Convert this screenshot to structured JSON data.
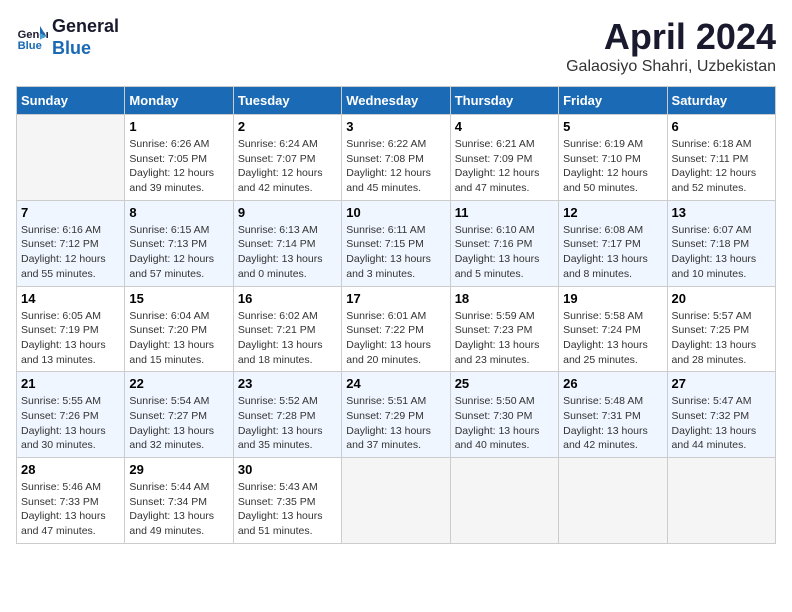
{
  "header": {
    "logo_line1": "General",
    "logo_line2": "Blue",
    "month_title": "April 2024",
    "location": "Galaosiyo Shahri, Uzbekistan"
  },
  "weekdays": [
    "Sunday",
    "Monday",
    "Tuesday",
    "Wednesday",
    "Thursday",
    "Friday",
    "Saturday"
  ],
  "weeks": [
    [
      {
        "day": "",
        "sunrise": "",
        "sunset": "",
        "daylight": ""
      },
      {
        "day": "1",
        "sunrise": "Sunrise: 6:26 AM",
        "sunset": "Sunset: 7:05 PM",
        "daylight": "Daylight: 12 hours and 39 minutes."
      },
      {
        "day": "2",
        "sunrise": "Sunrise: 6:24 AM",
        "sunset": "Sunset: 7:07 PM",
        "daylight": "Daylight: 12 hours and 42 minutes."
      },
      {
        "day": "3",
        "sunrise": "Sunrise: 6:22 AM",
        "sunset": "Sunset: 7:08 PM",
        "daylight": "Daylight: 12 hours and 45 minutes."
      },
      {
        "day": "4",
        "sunrise": "Sunrise: 6:21 AM",
        "sunset": "Sunset: 7:09 PM",
        "daylight": "Daylight: 12 hours and 47 minutes."
      },
      {
        "day": "5",
        "sunrise": "Sunrise: 6:19 AM",
        "sunset": "Sunset: 7:10 PM",
        "daylight": "Daylight: 12 hours and 50 minutes."
      },
      {
        "day": "6",
        "sunrise": "Sunrise: 6:18 AM",
        "sunset": "Sunset: 7:11 PM",
        "daylight": "Daylight: 12 hours and 52 minutes."
      }
    ],
    [
      {
        "day": "7",
        "sunrise": "Sunrise: 6:16 AM",
        "sunset": "Sunset: 7:12 PM",
        "daylight": "Daylight: 12 hours and 55 minutes."
      },
      {
        "day": "8",
        "sunrise": "Sunrise: 6:15 AM",
        "sunset": "Sunset: 7:13 PM",
        "daylight": "Daylight: 12 hours and 57 minutes."
      },
      {
        "day": "9",
        "sunrise": "Sunrise: 6:13 AM",
        "sunset": "Sunset: 7:14 PM",
        "daylight": "Daylight: 13 hours and 0 minutes."
      },
      {
        "day": "10",
        "sunrise": "Sunrise: 6:11 AM",
        "sunset": "Sunset: 7:15 PM",
        "daylight": "Daylight: 13 hours and 3 minutes."
      },
      {
        "day": "11",
        "sunrise": "Sunrise: 6:10 AM",
        "sunset": "Sunset: 7:16 PM",
        "daylight": "Daylight: 13 hours and 5 minutes."
      },
      {
        "day": "12",
        "sunrise": "Sunrise: 6:08 AM",
        "sunset": "Sunset: 7:17 PM",
        "daylight": "Daylight: 13 hours and 8 minutes."
      },
      {
        "day": "13",
        "sunrise": "Sunrise: 6:07 AM",
        "sunset": "Sunset: 7:18 PM",
        "daylight": "Daylight: 13 hours and 10 minutes."
      }
    ],
    [
      {
        "day": "14",
        "sunrise": "Sunrise: 6:05 AM",
        "sunset": "Sunset: 7:19 PM",
        "daylight": "Daylight: 13 hours and 13 minutes."
      },
      {
        "day": "15",
        "sunrise": "Sunrise: 6:04 AM",
        "sunset": "Sunset: 7:20 PM",
        "daylight": "Daylight: 13 hours and 15 minutes."
      },
      {
        "day": "16",
        "sunrise": "Sunrise: 6:02 AM",
        "sunset": "Sunset: 7:21 PM",
        "daylight": "Daylight: 13 hours and 18 minutes."
      },
      {
        "day": "17",
        "sunrise": "Sunrise: 6:01 AM",
        "sunset": "Sunset: 7:22 PM",
        "daylight": "Daylight: 13 hours and 20 minutes."
      },
      {
        "day": "18",
        "sunrise": "Sunrise: 5:59 AM",
        "sunset": "Sunset: 7:23 PM",
        "daylight": "Daylight: 13 hours and 23 minutes."
      },
      {
        "day": "19",
        "sunrise": "Sunrise: 5:58 AM",
        "sunset": "Sunset: 7:24 PM",
        "daylight": "Daylight: 13 hours and 25 minutes."
      },
      {
        "day": "20",
        "sunrise": "Sunrise: 5:57 AM",
        "sunset": "Sunset: 7:25 PM",
        "daylight": "Daylight: 13 hours and 28 minutes."
      }
    ],
    [
      {
        "day": "21",
        "sunrise": "Sunrise: 5:55 AM",
        "sunset": "Sunset: 7:26 PM",
        "daylight": "Daylight: 13 hours and 30 minutes."
      },
      {
        "day": "22",
        "sunrise": "Sunrise: 5:54 AM",
        "sunset": "Sunset: 7:27 PM",
        "daylight": "Daylight: 13 hours and 32 minutes."
      },
      {
        "day": "23",
        "sunrise": "Sunrise: 5:52 AM",
        "sunset": "Sunset: 7:28 PM",
        "daylight": "Daylight: 13 hours and 35 minutes."
      },
      {
        "day": "24",
        "sunrise": "Sunrise: 5:51 AM",
        "sunset": "Sunset: 7:29 PM",
        "daylight": "Daylight: 13 hours and 37 minutes."
      },
      {
        "day": "25",
        "sunrise": "Sunrise: 5:50 AM",
        "sunset": "Sunset: 7:30 PM",
        "daylight": "Daylight: 13 hours and 40 minutes."
      },
      {
        "day": "26",
        "sunrise": "Sunrise: 5:48 AM",
        "sunset": "Sunset: 7:31 PM",
        "daylight": "Daylight: 13 hours and 42 minutes."
      },
      {
        "day": "27",
        "sunrise": "Sunrise: 5:47 AM",
        "sunset": "Sunset: 7:32 PM",
        "daylight": "Daylight: 13 hours and 44 minutes."
      }
    ],
    [
      {
        "day": "28",
        "sunrise": "Sunrise: 5:46 AM",
        "sunset": "Sunset: 7:33 PM",
        "daylight": "Daylight: 13 hours and 47 minutes."
      },
      {
        "day": "29",
        "sunrise": "Sunrise: 5:44 AM",
        "sunset": "Sunset: 7:34 PM",
        "daylight": "Daylight: 13 hours and 49 minutes."
      },
      {
        "day": "30",
        "sunrise": "Sunrise: 5:43 AM",
        "sunset": "Sunset: 7:35 PM",
        "daylight": "Daylight: 13 hours and 51 minutes."
      },
      {
        "day": "",
        "sunrise": "",
        "sunset": "",
        "daylight": ""
      },
      {
        "day": "",
        "sunrise": "",
        "sunset": "",
        "daylight": ""
      },
      {
        "day": "",
        "sunrise": "",
        "sunset": "",
        "daylight": ""
      },
      {
        "day": "",
        "sunrise": "",
        "sunset": "",
        "daylight": ""
      }
    ]
  ]
}
